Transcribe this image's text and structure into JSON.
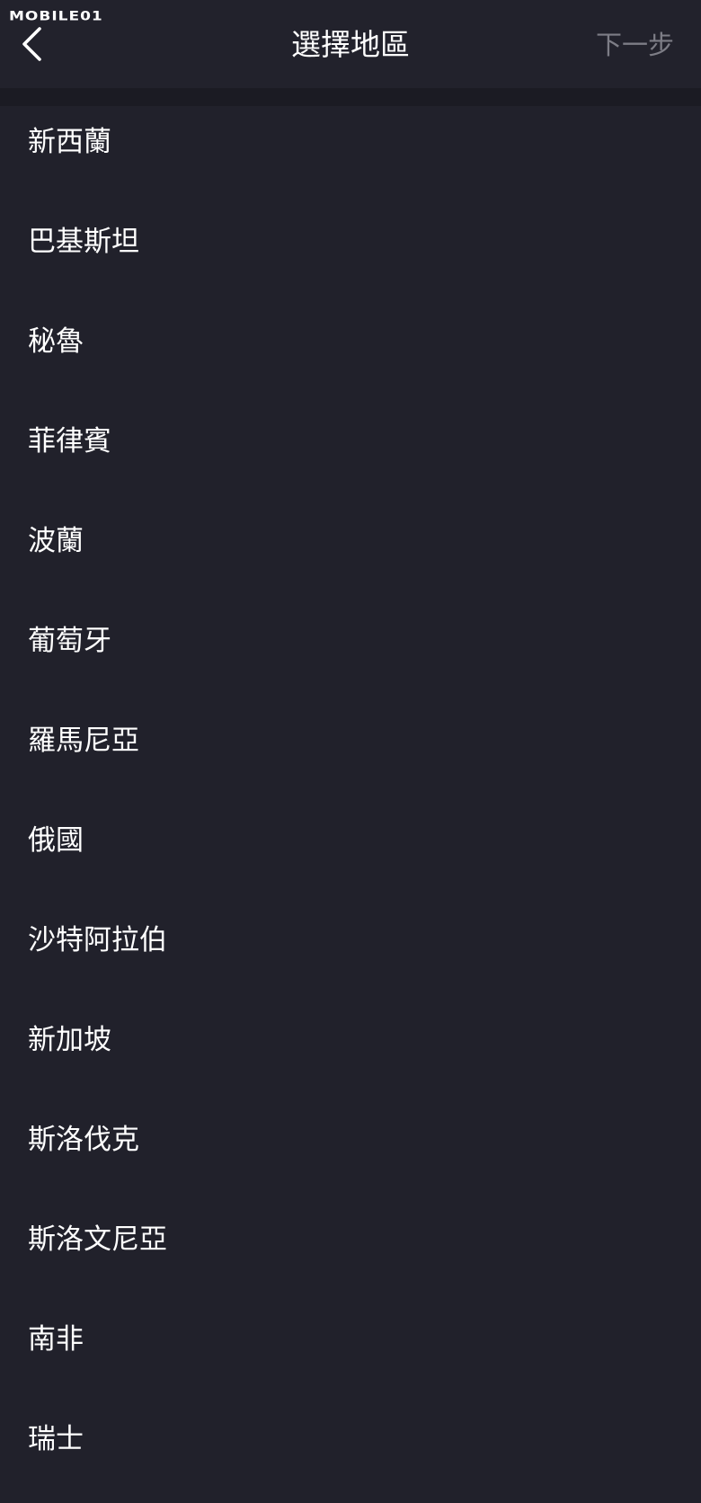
{
  "watermark": {
    "text": "MOBILE01"
  },
  "header": {
    "back_icon": "chevron-left-icon",
    "title": "選擇地區",
    "next_label": "下一步",
    "next_color": "#7d7d86"
  },
  "colors": {
    "background": "#21212b",
    "header_background": "#22222c",
    "separator": "#1b1b23",
    "text": "#ffffff"
  },
  "regions": [
    {
      "label": "新西蘭"
    },
    {
      "label": "巴基斯坦"
    },
    {
      "label": "秘魯"
    },
    {
      "label": "菲律賓"
    },
    {
      "label": "波蘭"
    },
    {
      "label": "葡萄牙"
    },
    {
      "label": "羅馬尼亞"
    },
    {
      "label": "俄國"
    },
    {
      "label": "沙特阿拉伯"
    },
    {
      "label": "新加坡"
    },
    {
      "label": "斯洛伐克"
    },
    {
      "label": "斯洛文尼亞"
    },
    {
      "label": "南非"
    },
    {
      "label": "瑞士"
    }
  ]
}
